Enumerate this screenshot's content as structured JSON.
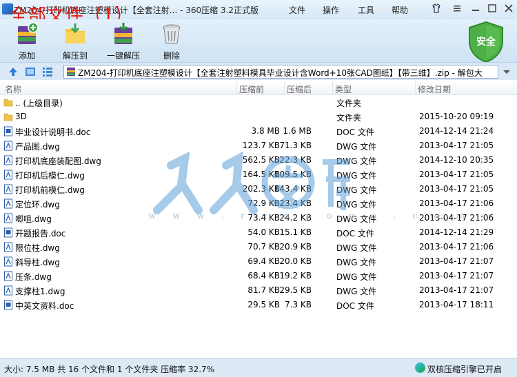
{
  "window": {
    "title": "ZM204-打印机底座注塑模设计【全套注射...  - 360压缩 3.2正式版",
    "overlay_text": "全部文件（1）"
  },
  "menu": [
    "文件",
    "操作",
    "工具",
    "帮助"
  ],
  "toolbar": {
    "buttons": [
      {
        "label": "添加",
        "icon": "add-icon"
      },
      {
        "label": "解压到",
        "icon": "extract-to-icon"
      },
      {
        "label": "一键解压",
        "icon": "one-click-extract-icon"
      },
      {
        "label": "删除",
        "icon": "delete-icon"
      }
    ],
    "security_badge": "安全"
  },
  "address": {
    "path": "ZM204-打印机底座注塑模设计【全套注射塑料模具毕业设计含Word+10张CAD图纸】【带三维】.zip - 解包大"
  },
  "columns": [
    "名称",
    "压缩前",
    "压缩后",
    "类型",
    "修改日期"
  ],
  "files": [
    {
      "name": ".. (上级目录)",
      "original": "",
      "compressed": "",
      "type": "文件夹",
      "date": "",
      "icon": "folder-icon"
    },
    {
      "name": "3D",
      "original": "",
      "compressed": "",
      "type": "文件夹",
      "date": "2015-10-20 09:19",
      "icon": "folder-icon"
    },
    {
      "name": "毕业设计说明书.doc",
      "original": "3.8 MB",
      "compressed": "1.6 MB",
      "type": "DOC 文件",
      "date": "2014-12-14 21:24",
      "icon": "doc-icon"
    },
    {
      "name": "产品图.dwg",
      "original": "123.7 KB",
      "compressed": "71.3 KB",
      "type": "DWG 文件",
      "date": "2013-04-17 21:05",
      "icon": "dwg-icon"
    },
    {
      "name": "打印机底座装配图.dwg",
      "original": "562.5 KB",
      "compressed": "522.3 KB",
      "type": "DWG 文件",
      "date": "2014-12-10 20:35",
      "icon": "dwg-icon"
    },
    {
      "name": "打印机后模仁.dwg",
      "original": "164.5 KB",
      "compressed": "109.5 KB",
      "type": "DWG 文件",
      "date": "2013-04-17 21:05",
      "icon": "dwg-icon"
    },
    {
      "name": "打印机前模仁.dwg",
      "original": "202.3 KB",
      "compressed": "143.4 KB",
      "type": "DWG 文件",
      "date": "2013-04-17 21:05",
      "icon": "dwg-icon"
    },
    {
      "name": "定位环.dwg",
      "original": "72.9 KB",
      "compressed": "23.4 KB",
      "type": "DWG 文件",
      "date": "2013-04-17 21:06",
      "icon": "dwg-icon"
    },
    {
      "name": "唧咀.dwg",
      "original": "73.4 KB",
      "compressed": "24.2 KB",
      "type": "DWG 文件",
      "date": "2013-04-17 21:06",
      "icon": "dwg-icon"
    },
    {
      "name": "开题报告.doc",
      "original": "54.0 KB",
      "compressed": "15.1 KB",
      "type": "DOC 文件",
      "date": "2014-12-14 21:29",
      "icon": "doc-icon"
    },
    {
      "name": "限位柱.dwg",
      "original": "70.7 KB",
      "compressed": "20.9 KB",
      "type": "DWG 文件",
      "date": "2013-04-17 21:06",
      "icon": "dwg-icon"
    },
    {
      "name": "斜导柱.dwg",
      "original": "69.4 KB",
      "compressed": "20.0 KB",
      "type": "DWG 文件",
      "date": "2013-04-17 21:07",
      "icon": "dwg-icon"
    },
    {
      "name": "压条.dwg",
      "original": "68.4 KB",
      "compressed": "19.2 KB",
      "type": "DWG 文件",
      "date": "2013-04-17 21:07",
      "icon": "dwg-icon"
    },
    {
      "name": "支撑柱1.dwg",
      "original": "81.7 KB",
      "compressed": "29.5 KB",
      "type": "DWG 文件",
      "date": "2013-04-17 21:07",
      "icon": "dwg-icon"
    },
    {
      "name": "中英文资料.doc",
      "original": "29.5 KB",
      "compressed": "7.3 KB",
      "type": "DOC 文件",
      "date": "2013-04-17 18:11",
      "icon": "doc-icon"
    }
  ],
  "watermark": {
    "chars": "人人文库",
    "url": "w w w . r e n r o o o . c o m"
  },
  "status": {
    "summary": "大小: 7.5 MB 共 16 个文件和 1 个文件夹 压缩率 32.7%",
    "association": "双核压缩引擎已开启"
  },
  "colors": {
    "toolbar_bg": "#cfe3f4",
    "overlay_red": "#e8170c",
    "security_green": "#4cb046"
  }
}
